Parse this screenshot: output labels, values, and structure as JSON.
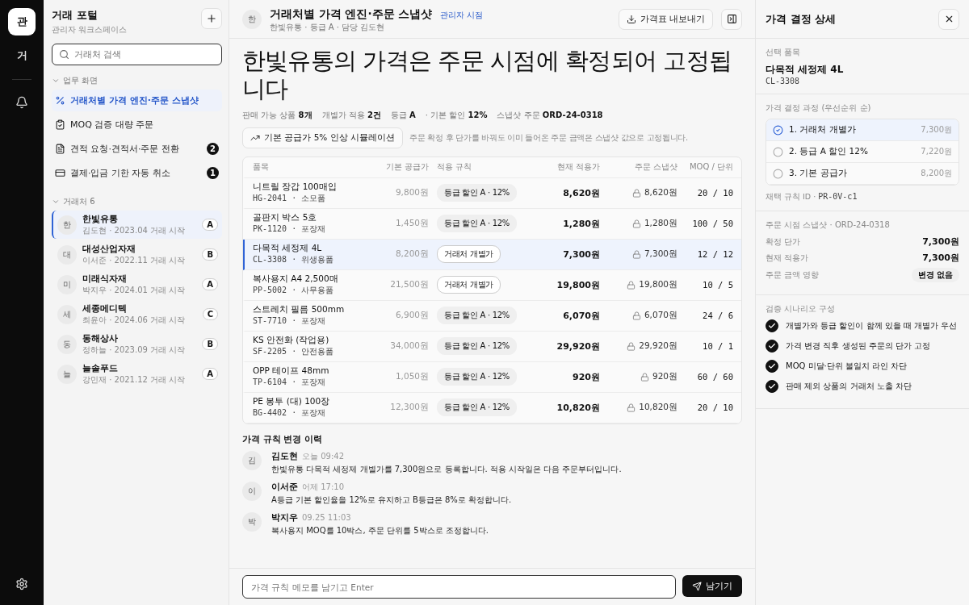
{
  "rail": {
    "items": [
      {
        "label": "관",
        "selected": true
      },
      {
        "label": "거",
        "selected": false
      }
    ]
  },
  "sidebar": {
    "title": "거래 포털",
    "subtitle": "관리자 워크스페이스",
    "search": {
      "placeholder": "거래처 검색"
    },
    "nav_section": "업무 화면",
    "nav": [
      {
        "kind": "percent",
        "label": "거래처별 가격 엔진·주문 스냅샷",
        "selected": true
      },
      {
        "kind": "clipboard",
        "label": "MOQ 검증 대량 주문",
        "selected": false
      },
      {
        "kind": "document",
        "label": "견적 요청·견적서·주문 전환",
        "selected": false,
        "badge": "2"
      },
      {
        "kind": "card",
        "label": "결제·입금 기한 자동 취소",
        "selected": false,
        "badge": "1"
      }
    ],
    "partners_section": "거래처 6",
    "partners": [
      {
        "initial": "한",
        "name": "한빛유통",
        "meta": "김도현 · 2023.04 거래 시작",
        "grade": "A",
        "selected": true
      },
      {
        "initial": "대",
        "name": "대성산업자재",
        "meta": "이서준 · 2022.11 거래 시작",
        "grade": "B",
        "selected": false
      },
      {
        "initial": "미",
        "name": "미래식자재",
        "meta": "박지우 · 2024.01 거래 시작",
        "grade": "A",
        "selected": false
      },
      {
        "initial": "세",
        "name": "세종메디텍",
        "meta": "최윤아 · 2024.06 거래 시작",
        "grade": "C",
        "selected": false
      },
      {
        "initial": "동",
        "name": "동해상사",
        "meta": "정하늘 · 2023.09 거래 시작",
        "grade": "B",
        "selected": false
      },
      {
        "initial": "늘",
        "name": "늘솔푸드",
        "meta": "강민재 · 2021.12 거래 시작",
        "grade": "A",
        "selected": false
      }
    ]
  },
  "header": {
    "initial": "한",
    "title": "거래처별 가격 엔진·주문 스냅샷",
    "badge": "관리자 시점",
    "subtitle": "한빛유통 · 등급 A · 담당 김도현",
    "export_button": "가격표 내보내기"
  },
  "headline": "한빛유통의 가격은 주문 시점에 확정되어 고정됩니다",
  "stats": [
    {
      "label": "판매 가능 상품",
      "value": "8개"
    },
    {
      "label": "개별가 적용",
      "value": "2건"
    },
    {
      "label": "등급",
      "value": "A"
    },
    {
      "label": "· 기본 할인",
      "value": "12%"
    },
    {
      "label": "스냅샷 주문",
      "value": "ORD-24-0318"
    }
  ],
  "simulate_button": "기본 공급가 5% 인상 시뮬레이션",
  "simulate_note": "주문 확정 후 단가를 바꿔도 이미 들어온 주문 금액은 스냅샷 값으로 고정됩니다.",
  "table": {
    "columns": [
      "품목",
      "기본 공급가",
      "적용 규칙",
      "현재 적용가",
      "주문 스냅샷",
      "MOQ / 단위"
    ],
    "rows": [
      {
        "name": "니트릴 장갑 100매입",
        "code": "HG-2041 · 소모품",
        "base": "9,800원",
        "rule": "등급 할인 A · 12%",
        "kind": "grade",
        "price": "8,620원",
        "snapshot": "8,620원",
        "moq": "20 / 10",
        "selected": false
      },
      {
        "name": "골판지 박스 5호",
        "code": "PK-1120 · 포장재",
        "base": "1,450원",
        "rule": "등급 할인 A · 12%",
        "kind": "grade",
        "price": "1,280원",
        "snapshot": "1,280원",
        "moq": "100 / 50",
        "selected": false
      },
      {
        "name": "다목적 세정제 4L",
        "code": "CL-3308 · 위생용품",
        "base": "8,200원",
        "rule": "거래처 개별가",
        "kind": "custom",
        "price": "7,300원",
        "snapshot": "7,300원",
        "moq": "12 / 12",
        "selected": true
      },
      {
        "name": "복사용지 A4 2,500매",
        "code": "PP-5002 · 사무용품",
        "base": "21,500원",
        "rule": "거래처 개별가",
        "kind": "custom",
        "price": "19,800원",
        "snapshot": "19,800원",
        "moq": "10 / 5",
        "selected": false
      },
      {
        "name": "스트레치 필름 500mm",
        "code": "ST-7710 · 포장재",
        "base": "6,900원",
        "rule": "등급 할인 A · 12%",
        "kind": "grade",
        "price": "6,070원",
        "snapshot": "6,070원",
        "moq": "24 / 6",
        "selected": false
      },
      {
        "name": "KS 안전화 (작업용)",
        "code": "SF-2205 · 안전용품",
        "base": "34,000원",
        "rule": "등급 할인 A · 12%",
        "kind": "grade",
        "price": "29,920원",
        "snapshot": "29,920원",
        "moq": "10 / 1",
        "selected": false
      },
      {
        "name": "OPP 테이프 48mm",
        "code": "TP-6104 · 포장재",
        "base": "1,050원",
        "rule": "등급 할인 A · 12%",
        "kind": "grade",
        "price": "920원",
        "snapshot": "920원",
        "moq": "60 / 60",
        "selected": false
      },
      {
        "name": "PE 봉투 (대) 100장",
        "code": "BG-4402 · 포장재",
        "base": "12,300원",
        "rule": "등급 할인 A · 12%",
        "kind": "grade",
        "price": "10,820원",
        "snapshot": "10,820원",
        "moq": "20 / 10",
        "selected": false
      }
    ]
  },
  "history": {
    "title": "가격 규칙 변경 이력",
    "entries": [
      {
        "initial": "김",
        "author": "김도현",
        "time": "오늘 09:42",
        "text": "한빛유통 다목적 세정제 개별가를 7,300원으로 등록합니다. 적용 시작일은 다음 주문부터입니다."
      },
      {
        "initial": "이",
        "author": "이서준",
        "time": "어제 17:10",
        "text": "A등급 기본 할인율을 12%로 유지하고 B등급은 8%로 확정합니다."
      },
      {
        "initial": "박",
        "author": "박지우",
        "time": "09.25 11:03",
        "text": "복사용지 MOQ를 10박스, 주문 단위를 5박스로 조정합니다."
      }
    ]
  },
  "composer": {
    "placeholder": "가격 규칙 메모를 남기고 Enter",
    "send_button": "남기기"
  },
  "detail": {
    "title": "가격 결정 상세",
    "item_label": "선택 품목",
    "item_name": "다목적 세정제 4L",
    "item_code": "CL-3308",
    "steps_label": "가격 결정 과정 (우선순위 순)",
    "steps": [
      {
        "label": "1. 거래처 개별가",
        "price": "7,300원",
        "selected": true
      },
      {
        "label": "2. 등급 A 할인 12%",
        "price": "7,220원",
        "selected": false
      },
      {
        "label": "3. 기본 공급가",
        "price": "8,200원",
        "selected": false
      }
    ],
    "rule_id_label": "채택 규칙 ID ·",
    "rule_id": "PR-0V-c1",
    "snapshot_label": "주문 시점 스냅샷 · ORD-24-0318",
    "snapshot_rows": [
      {
        "kind": "value",
        "label": "확정 단가",
        "value": "7,300원"
      },
      {
        "kind": "value",
        "label": "현재 적용가",
        "value": "7,300원"
      },
      {
        "kind": "pill",
        "label": "주문 금액 영향",
        "value": "변경 없음"
      }
    ],
    "scenario_label": "검증 시나리오 구성",
    "scenarios": [
      {
        "label": "개별가와 등급 할인이 함께 있을 때 개별가 우선",
        "checked": true
      },
      {
        "label": "가격 변경 직후 생성된 주문의 단가 고정",
        "checked": true
      },
      {
        "label": "MOQ 미달·단위 불일치 라인 차단",
        "checked": true
      },
      {
        "label": "판매 제외 상품의 거래처 노출 차단",
        "checked": true
      }
    ]
  }
}
